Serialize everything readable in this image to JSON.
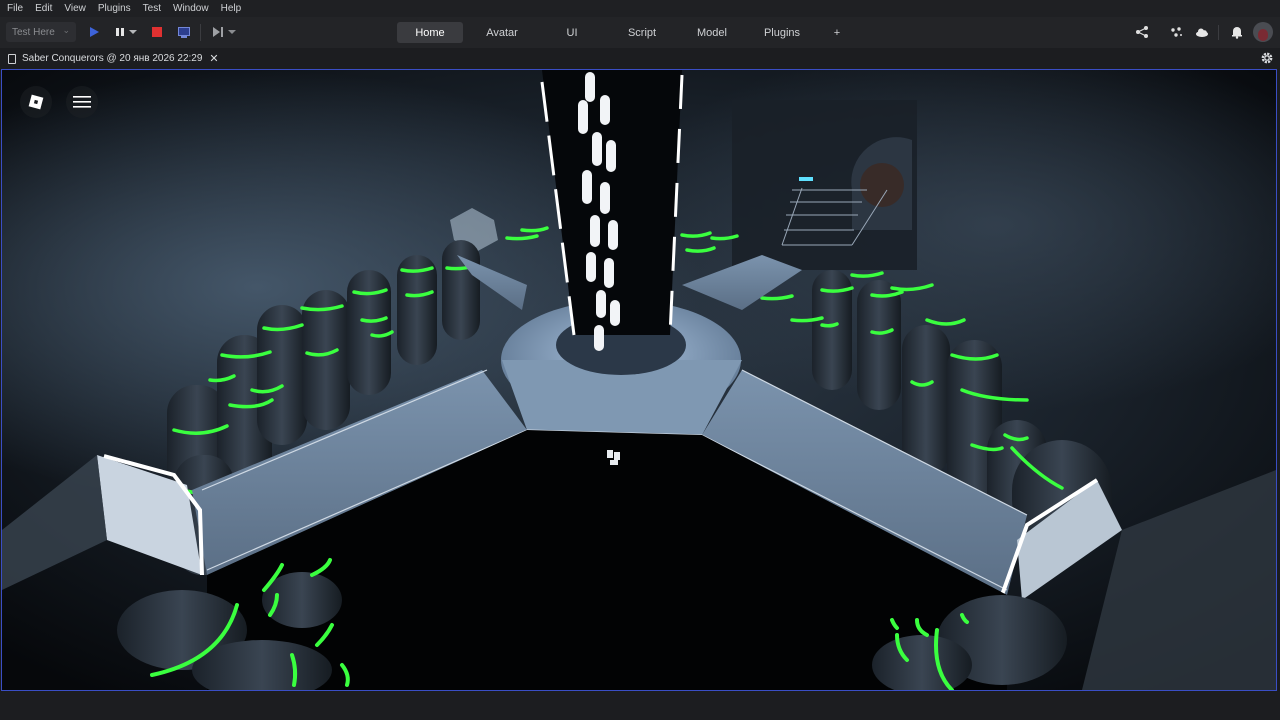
{
  "menu": [
    "File",
    "Edit",
    "View",
    "Plugins",
    "Test",
    "Window",
    "Help"
  ],
  "toolbar": {
    "test_mode": "Test Here",
    "tabs": [
      "Home",
      "Avatar",
      "UI",
      "Script",
      "Model",
      "Plugins",
      "+"
    ],
    "active_tab": "Home"
  },
  "document": {
    "tab_title": "Saber Conquerors @ 20 янв 2026 22:29"
  },
  "icons": {
    "play": "play-icon",
    "pause": "pause-icon",
    "stop": "stop-icon",
    "screen": "screen-icon",
    "step": "step-icon",
    "share": "share-icon",
    "collab": "collaborators-icon",
    "cloud": "cloud-icon",
    "bell": "bell-icon",
    "avatar": "avatar",
    "gear": "gear-icon",
    "roblox": "roblox-logo-icon",
    "menu": "hamburger-menu-icon"
  },
  "colors": {
    "accent_blue": "#3a4ec5",
    "stop_red": "#e03131",
    "neon_green": "#39ff3a"
  }
}
